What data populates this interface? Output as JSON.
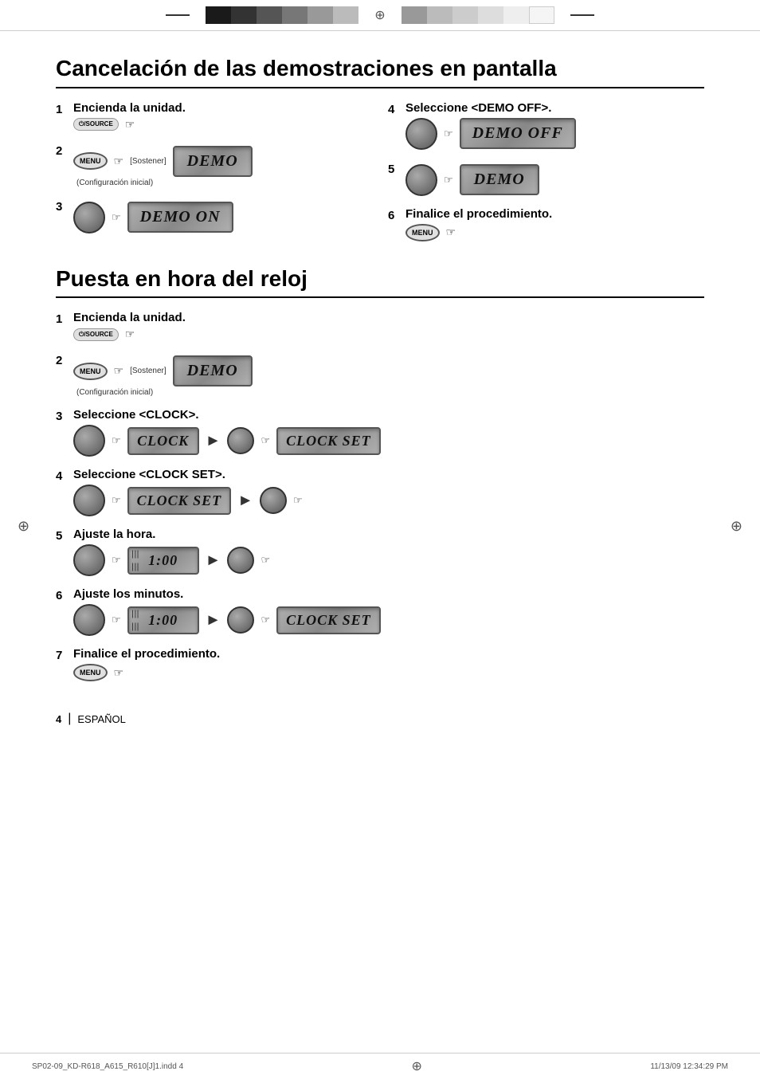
{
  "top_bar": {
    "swatches_left": [
      "#1a1a1a",
      "#333",
      "#555",
      "#777",
      "#999",
      "#bbb"
    ],
    "swatches_right": [
      "#999",
      "#bbb",
      "#ccc",
      "#ddd",
      "#eee",
      "#f5f5f5"
    ],
    "crosshair": "⊕"
  },
  "section1": {
    "title": "Cancelación de las demostraciones en pantalla",
    "steps": [
      {
        "number": "1",
        "label": "Encienda la unidad.",
        "note": ""
      },
      {
        "number": "2",
        "label": "",
        "sostener": "[Sostener]",
        "display": "DEMO",
        "subcaption": "(Configuración inicial)"
      },
      {
        "number": "3",
        "label": "",
        "display": "DEMO ON"
      },
      {
        "number": "4",
        "label": "Seleccione <DEMO OFF>.",
        "display": "DEMO OFF"
      },
      {
        "number": "5",
        "label": "",
        "display": "DEMO"
      },
      {
        "number": "6",
        "label": "Finalice el procedimiento.",
        "note": ""
      }
    ]
  },
  "section2": {
    "title": "Puesta en hora del reloj",
    "steps": [
      {
        "number": "1",
        "label": "Encienda la unidad."
      },
      {
        "number": "2",
        "label": "",
        "sostener": "[Sostener]",
        "display": "DEMO",
        "subcaption": "(Configuración inicial)"
      },
      {
        "number": "3",
        "label": "Seleccione <CLOCK>.",
        "display1": "CLOCK",
        "display2": "CLOCK SET"
      },
      {
        "number": "4",
        "label": "Seleccione <CLOCK SET>.",
        "display1": "CLOCK SET"
      },
      {
        "number": "5",
        "label": "Ajuste la hora.",
        "display1": "1:00"
      },
      {
        "number": "6",
        "label": "Ajuste los minutos.",
        "display1": "1:00",
        "display2": "CLOCK SET"
      },
      {
        "number": "7",
        "label": "Finalice el procedimiento."
      }
    ]
  },
  "footer": {
    "page": "4",
    "lang": "ESPAÑOL",
    "separator": "|",
    "file_info": "SP02-09_KD-R618_A615_R610[J]1.indd   4",
    "date_info": "11/13/09   12:34:29 PM"
  }
}
